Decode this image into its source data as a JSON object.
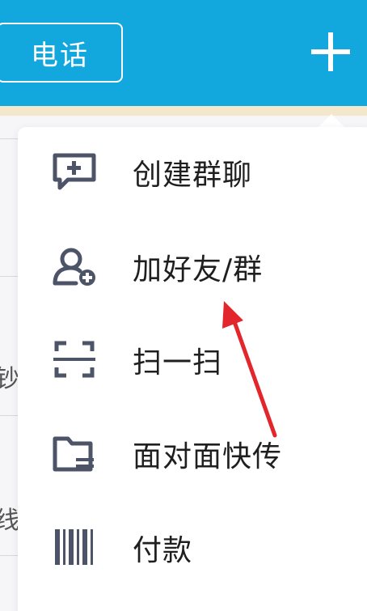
{
  "header": {
    "tab_phone_label": "电话",
    "plus_icon": "plus-icon"
  },
  "background": {
    "partial_chars": [
      "钞",
      "线"
    ]
  },
  "menu": {
    "items": [
      {
        "label": "创建群聊",
        "icon": "chat-plus-icon"
      },
      {
        "label": "加好友/群",
        "icon": "add-user-icon"
      },
      {
        "label": "扫一扫",
        "icon": "scan-icon"
      },
      {
        "label": "面对面快传",
        "icon": "folder-transfer-icon"
      },
      {
        "label": "付款",
        "icon": "barcode-icon"
      }
    ]
  },
  "colors": {
    "header_bg": "#12a8de",
    "icon_color": "#4e5468",
    "annotation": "#e3262c"
  }
}
